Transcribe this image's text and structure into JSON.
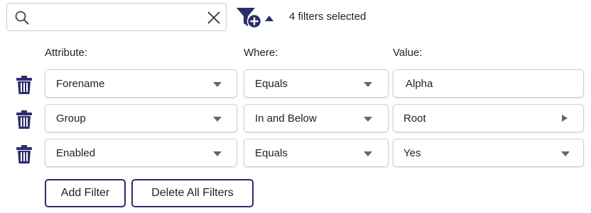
{
  "search": {
    "value": "",
    "placeholder": ""
  },
  "filter_summary": "4 filters selected",
  "headers": {
    "attribute": "Attribute:",
    "where": "Where:",
    "value": "Value:"
  },
  "rows": [
    {
      "attribute": "Forename",
      "where": "Equals",
      "value": "Alpha",
      "value_control": "text"
    },
    {
      "attribute": "Group",
      "where": "In and Below",
      "value": "Root",
      "value_control": "tree-picker"
    },
    {
      "attribute": "Enabled",
      "where": "Equals",
      "value": "Yes",
      "value_control": "dropdown"
    }
  ],
  "buttons": {
    "add_filter": "Add Filter",
    "delete_all": "Delete All Filters"
  },
  "colors": {
    "accent": "#2b2d6b",
    "icon": "#2b2d6b",
    "border": "#cfcfcf"
  },
  "icons": [
    "search-icon",
    "clear-icon",
    "add-filter-icon",
    "caret-up-icon",
    "trash-icon",
    "chevron-down-icon",
    "chevron-right-icon"
  ]
}
